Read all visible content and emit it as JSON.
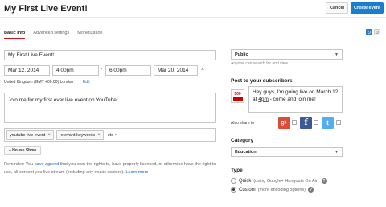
{
  "header": {
    "title": "My First Live Event!",
    "cancel_label": "Cancel",
    "create_label": "Create event"
  },
  "tabs": [
    {
      "label": "Basic info",
      "active": true
    },
    {
      "label": "Advanced settings",
      "active": false
    },
    {
      "label": "Monetization",
      "active": false
    }
  ],
  "form": {
    "title_value": "My First Live Event!",
    "start_date": "Mar 12, 2014",
    "start_time": "4:00pm",
    "time_separator": "-",
    "end_time": "6:00pm",
    "end_date": "Mar 20, 2014",
    "close_glyph": "×",
    "timezone": "United Kingdom (GMT +00:00) London",
    "timezone_edit": "Edit",
    "description": "Join me for my first ever live event on YouTube!",
    "tags": [
      "youtube live event",
      "relevant keywords",
      "etc"
    ],
    "tag_remove_glyph": "×",
    "house_show_label": "+ House Show"
  },
  "reminder": {
    "part1": "Reminder: You ",
    "link1": "have agreed",
    "part2": " that you own the rights to, have properly licensed, or otherwise have the right to use, all content you live stream (including any music content). ",
    "link2": "Learn more"
  },
  "privacy": {
    "selected": "Public",
    "help": "Anyone can search for and view"
  },
  "post": {
    "heading": "Post to your subscribers",
    "avatar_text": "500",
    "text_before": "Hey guys, I'm going live on March 12 at ",
    "text_underlined": "4pm",
    "text_after": " - come and join me!",
    "share_label": "Also share to",
    "networks": [
      {
        "name": "google-plus",
        "glyph": "g+",
        "color": "#dd4b39"
      },
      {
        "name": "facebook",
        "glyph": "f",
        "color": "#3b5998"
      },
      {
        "name": "twitter",
        "glyph": "t",
        "color": "#55acee"
      }
    ]
  },
  "category": {
    "heading": "Category",
    "selected": "Education"
  },
  "type": {
    "heading": "Type",
    "options": [
      {
        "label": "Quick",
        "sub": "(using Google+ Hangouts On Air)",
        "selected": false
      },
      {
        "label": "Custom",
        "sub": "(more encoding options)",
        "selected": true
      }
    ],
    "help_glyph": "?"
  },
  "icons": {
    "caret": "▼",
    "refresh": "↻",
    "settings": "⚙"
  },
  "colors": {
    "accent_blue": "#1b7fcc",
    "active_tab": "#cc181e",
    "link": "#1a65c0"
  }
}
